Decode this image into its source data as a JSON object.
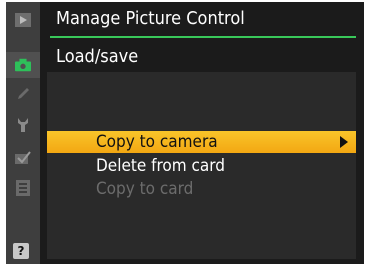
{
  "header": {
    "title": "Manage Picture Control",
    "subtitle": "Load/save"
  },
  "menu": {
    "items": [
      {
        "label": "Copy to camera",
        "state": "selected",
        "has_submenu": true
      },
      {
        "label": "Delete from card",
        "state": "normal",
        "has_submenu": false
      },
      {
        "label": "Copy to card",
        "state": "disabled",
        "has_submenu": false
      }
    ]
  },
  "sidebar": {
    "icons": [
      "playback-icon",
      "camera-icon",
      "pencil-icon",
      "wrench-icon",
      "retouch-icon",
      "my-menu-icon"
    ],
    "help_label": "?"
  },
  "colors": {
    "accent_rule": "#39c85a",
    "selection": "#f5b21a",
    "camera_icon": "#2ec05a"
  }
}
